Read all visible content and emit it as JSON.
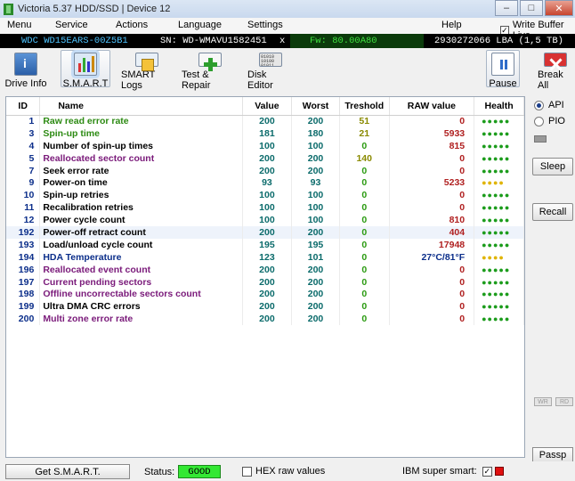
{
  "window": {
    "title": "Victoria 5.37 HDD/SSD | Device 12",
    "min": "–",
    "max": "□",
    "close": "✕"
  },
  "menu": [
    "Menu",
    "Service",
    "Actions",
    "Language",
    "Settings",
    "Help"
  ],
  "buffer_live": {
    "label": "Write Buffer Live",
    "checked": "✓"
  },
  "drive": {
    "model": "WDC WD15EARS-00Z5B1",
    "serial": "SN: WD-WMAVU1582451",
    "close_mark": "x",
    "firmware": "Fw: 80.00A80",
    "lba": "2930272066 LBA (1,5 TB)"
  },
  "toolbar": {
    "drive_info": "Drive Info",
    "smart": "S.M.A.R.T",
    "smart_logs": "SMART Logs",
    "test_repair": "Test & Repair",
    "disk_editor": "Disk Editor",
    "disk_editor_icon_text": "01010 10100 01011 10100 01010",
    "pause": "Pause",
    "break_all": "Break All"
  },
  "table": {
    "headers": {
      "id": "ID",
      "name": "Name",
      "value": "Value",
      "worst": "Worst",
      "threshold": "Treshold",
      "raw": "RAW value",
      "health": "Health"
    },
    "rows": [
      {
        "id": "1",
        "name": "Raw read error rate",
        "value": "200",
        "worst": "200",
        "threshold": "51",
        "raw": "0",
        "health": "●●●●●"
      },
      {
        "id": "3",
        "name": "Spin-up time",
        "value": "181",
        "worst": "180",
        "threshold": "21",
        "raw": "5933",
        "health": "●●●●●"
      },
      {
        "id": "4",
        "name": "Number of spin-up times",
        "value": "100",
        "worst": "100",
        "threshold": "0",
        "raw": "815",
        "health": "●●●●●"
      },
      {
        "id": "5",
        "name": "Reallocated sector count",
        "value": "200",
        "worst": "200",
        "threshold": "140",
        "raw": "0",
        "health": "●●●●●"
      },
      {
        "id": "7",
        "name": "Seek error rate",
        "value": "200",
        "worst": "200",
        "threshold": "0",
        "raw": "0",
        "health": "●●●●●"
      },
      {
        "id": "9",
        "name": "Power-on time",
        "value": "93",
        "worst": "93",
        "threshold": "0",
        "raw": "5233",
        "health": "●●●●"
      },
      {
        "id": "10",
        "name": "Spin-up retries",
        "value": "100",
        "worst": "100",
        "threshold": "0",
        "raw": "0",
        "health": "●●●●●"
      },
      {
        "id": "11",
        "name": "Recalibration retries",
        "value": "100",
        "worst": "100",
        "threshold": "0",
        "raw": "0",
        "health": "●●●●●"
      },
      {
        "id": "12",
        "name": "Power cycle count",
        "value": "100",
        "worst": "100",
        "threshold": "0",
        "raw": "810",
        "health": "●●●●●"
      },
      {
        "id": "192",
        "name": "Power-off retract count",
        "value": "200",
        "worst": "200",
        "threshold": "0",
        "raw": "404",
        "health": "●●●●●"
      },
      {
        "id": "193",
        "name": "Load/unload cycle count",
        "value": "195",
        "worst": "195",
        "threshold": "0",
        "raw": "17948",
        "health": "●●●●●"
      },
      {
        "id": "194",
        "name": "HDA Temperature",
        "value": "123",
        "worst": "101",
        "threshold": "0",
        "raw": "27°C/81°F",
        "health": "●●●●"
      },
      {
        "id": "196",
        "name": "Reallocated event count",
        "value": "200",
        "worst": "200",
        "threshold": "0",
        "raw": "0",
        "health": "●●●●●"
      },
      {
        "id": "197",
        "name": "Current pending sectors",
        "value": "200",
        "worst": "200",
        "threshold": "0",
        "raw": "0",
        "health": "●●●●●"
      },
      {
        "id": "198",
        "name": "Offline uncorrectable sectors count",
        "value": "200",
        "worst": "200",
        "threshold": "0",
        "raw": "0",
        "health": "●●●●●"
      },
      {
        "id": "199",
        "name": "Ultra DMA CRC errors",
        "value": "200",
        "worst": "200",
        "threshold": "0",
        "raw": "0",
        "health": "●●●●●"
      },
      {
        "id": "200",
        "name": "Multi zone error rate",
        "value": "200",
        "worst": "200",
        "threshold": "0",
        "raw": "0",
        "health": "●●●●●"
      }
    ]
  },
  "side": {
    "api": "API",
    "pio": "PIO",
    "sleep": "Sleep",
    "recall": "Recall",
    "wr": "WR",
    "rd": "RD",
    "passp": "Passp"
  },
  "status": {
    "get_smart": "Get S.M.A.R.T.",
    "status_label": "Status:",
    "status_value": "GOOD",
    "hex_raw": "HEX raw values",
    "ibm_super_smart": "IBM super smart:",
    "ibm_checked": "✓"
  },
  "colors": {
    "status_good": "#33e833",
    "health_green": "#1c9c1c",
    "health_yellow": "#e0b400",
    "raw_red": "#b02020"
  }
}
